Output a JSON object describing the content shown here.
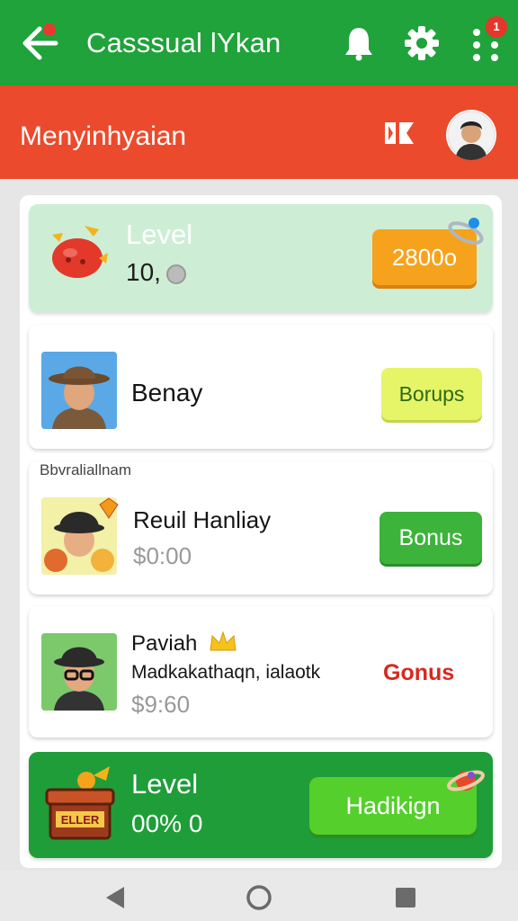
{
  "header": {
    "title": "Casssual lYkan",
    "notification_badge": "1",
    "icons": {
      "back": "arrow-left-icon",
      "bell": "bell-icon",
      "settings": "gear-icon",
      "more": "more-vertical-icon"
    },
    "color": "#1fa33a"
  },
  "subheader": {
    "title": "Menyinhyaian",
    "color": "#ec4a2c"
  },
  "level_card_top": {
    "label": "Level",
    "value": "10,",
    "button_label": "2800o"
  },
  "cards": [
    {
      "name": "Benay",
      "button_label": "Borups"
    },
    {
      "caption": "Bbvraliallnam",
      "name": "Reuil Hanliay",
      "price": "$0:00",
      "button_label": "Bonus"
    },
    {
      "name": "Paviah",
      "description": "Madkakathaqn, ialaotk",
      "price": "$9:60",
      "button_label": "Gonus"
    }
  ],
  "level_card_bottom": {
    "label": "Level",
    "value": "00% 0",
    "button_label": "Hadikign",
    "chest_text": "ELLER"
  },
  "navbar": {
    "icons": [
      "triangle-back-icon",
      "circle-home-icon",
      "square-recents-icon"
    ]
  }
}
